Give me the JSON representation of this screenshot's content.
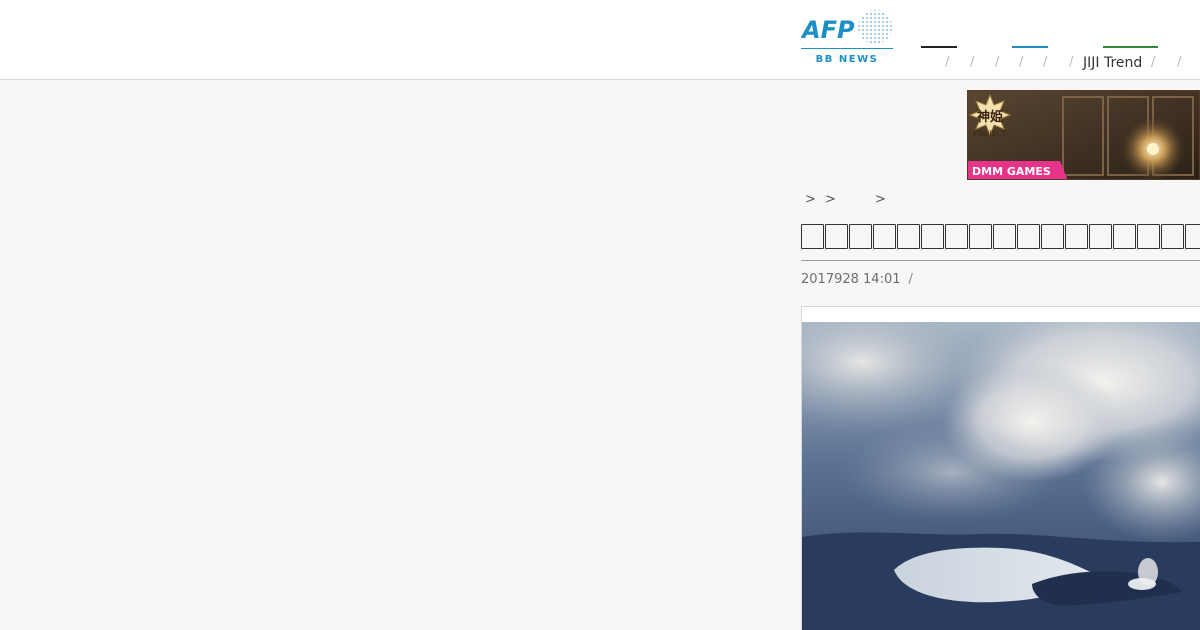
{
  "header": {
    "logo_main": "AFP",
    "logo_sub": "BB NEWS",
    "nav_label": "JIJI Trend",
    "nav_separator": "/"
  },
  "ad_banner": {
    "game_title": "神姫",
    "game_subtitle": "PROJECT",
    "publisher": "DMM GAMES"
  },
  "breadcrumb": {
    "separator": ">"
  },
  "article": {
    "headline_glyph_count": 17,
    "timestamp": "2017928 14:01",
    "meta_separator": "/"
  },
  "colors": {
    "accent_blue": "#1e8fc6",
    "accent_green": "#2f8a3d",
    "ad_pink": "#e8338a"
  }
}
